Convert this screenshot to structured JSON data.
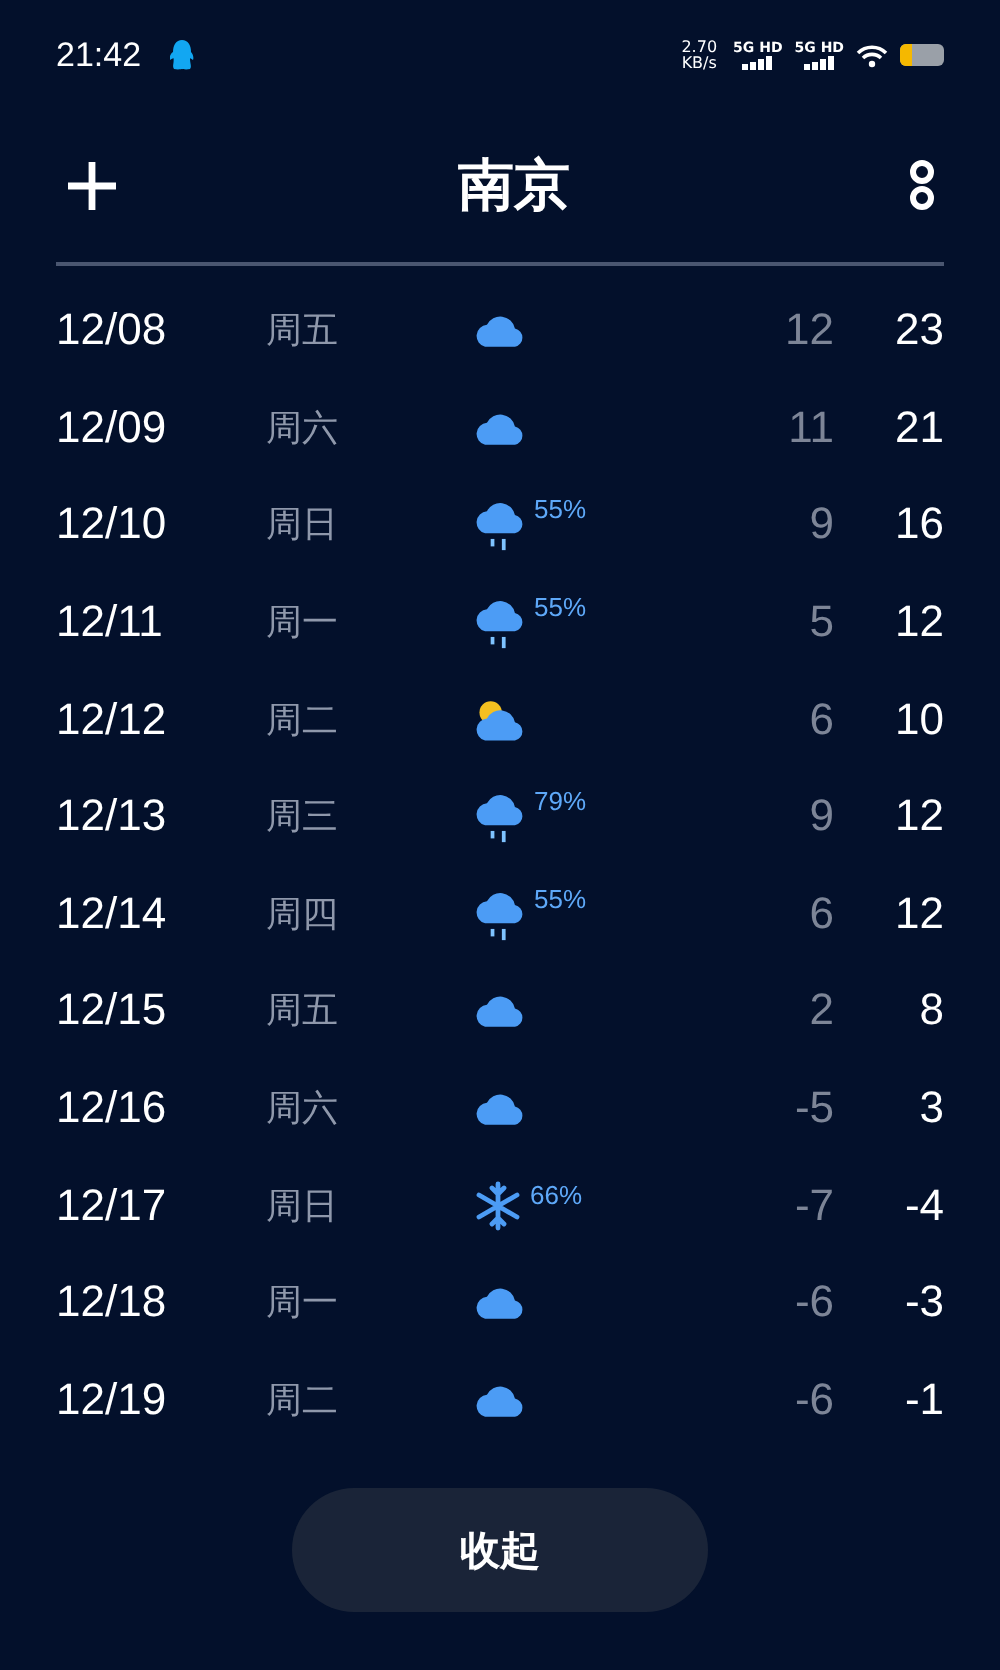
{
  "status_bar": {
    "time": "21:42",
    "speed": "2.70",
    "speed_unit": "KB/s",
    "networks": [
      "5G HD",
      "5G HD"
    ]
  },
  "header": {
    "title": "南京"
  },
  "days": [
    {
      "date": "12/08",
      "weekday": "周五",
      "kind": "cloudy",
      "low": "12",
      "high": "23"
    },
    {
      "date": "12/09",
      "weekday": "周六",
      "kind": "cloudy",
      "low": "11",
      "high": "21"
    },
    {
      "date": "12/10",
      "weekday": "周日",
      "kind": "rain",
      "chance": "55%",
      "low": "9",
      "high": "16"
    },
    {
      "date": "12/11",
      "weekday": "周一",
      "kind": "rain",
      "chance": "55%",
      "low": "5",
      "high": "12"
    },
    {
      "date": "12/12",
      "weekday": "周二",
      "kind": "partly-cloudy",
      "low": "6",
      "high": "10"
    },
    {
      "date": "12/13",
      "weekday": "周三",
      "kind": "rain",
      "chance": "79%",
      "low": "9",
      "high": "12"
    },
    {
      "date": "12/14",
      "weekday": "周四",
      "kind": "rain",
      "chance": "55%",
      "low": "6",
      "high": "12"
    },
    {
      "date": "12/15",
      "weekday": "周五",
      "kind": "cloudy",
      "low": "2",
      "high": "8"
    },
    {
      "date": "12/16",
      "weekday": "周六",
      "kind": "cloudy",
      "low": "-5",
      "high": "3"
    },
    {
      "date": "12/17",
      "weekday": "周日",
      "kind": "snow",
      "chance": "66%",
      "low": "-7",
      "high": "-4"
    },
    {
      "date": "12/18",
      "weekday": "周一",
      "kind": "cloudy",
      "low": "-6",
      "high": "-3"
    },
    {
      "date": "12/19",
      "weekday": "周二",
      "kind": "cloudy",
      "low": "-6",
      "high": "-1"
    }
  ],
  "collapse_button": "收起"
}
